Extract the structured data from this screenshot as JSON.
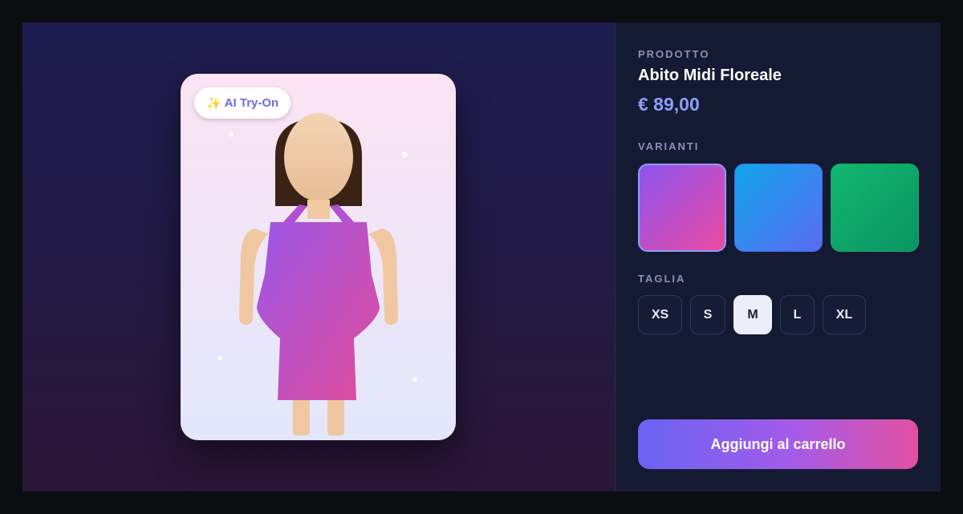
{
  "tryon": {
    "badge_label": "AI Try-On",
    "badge_icon": "sparkles-icon"
  },
  "product": {
    "section_label": "PRODOTTO",
    "name": "Abito Midi Floreale",
    "price": "€ 89,00"
  },
  "variants": {
    "section_label": "VARIANTI",
    "items": [
      {
        "colors": [
          "#8b55f0",
          "#ec4aa0"
        ],
        "selected": true
      },
      {
        "colors": [
          "#10a6ea",
          "#5b6af2"
        ],
        "selected": false
      },
      {
        "colors": [
          "#12b76f",
          "#0a9463"
        ],
        "selected": false
      }
    ]
  },
  "size": {
    "section_label": "TAGLIA",
    "options": [
      "XS",
      "S",
      "M",
      "L",
      "XL"
    ],
    "selected": "M"
  },
  "cart": {
    "button_label": "Aggiungi al carrello"
  },
  "colors": {
    "accent": "#8e9cff",
    "panel_bg": "#141a32",
    "dress_start": "#9b57e8",
    "dress_end": "#e24c9a"
  }
}
